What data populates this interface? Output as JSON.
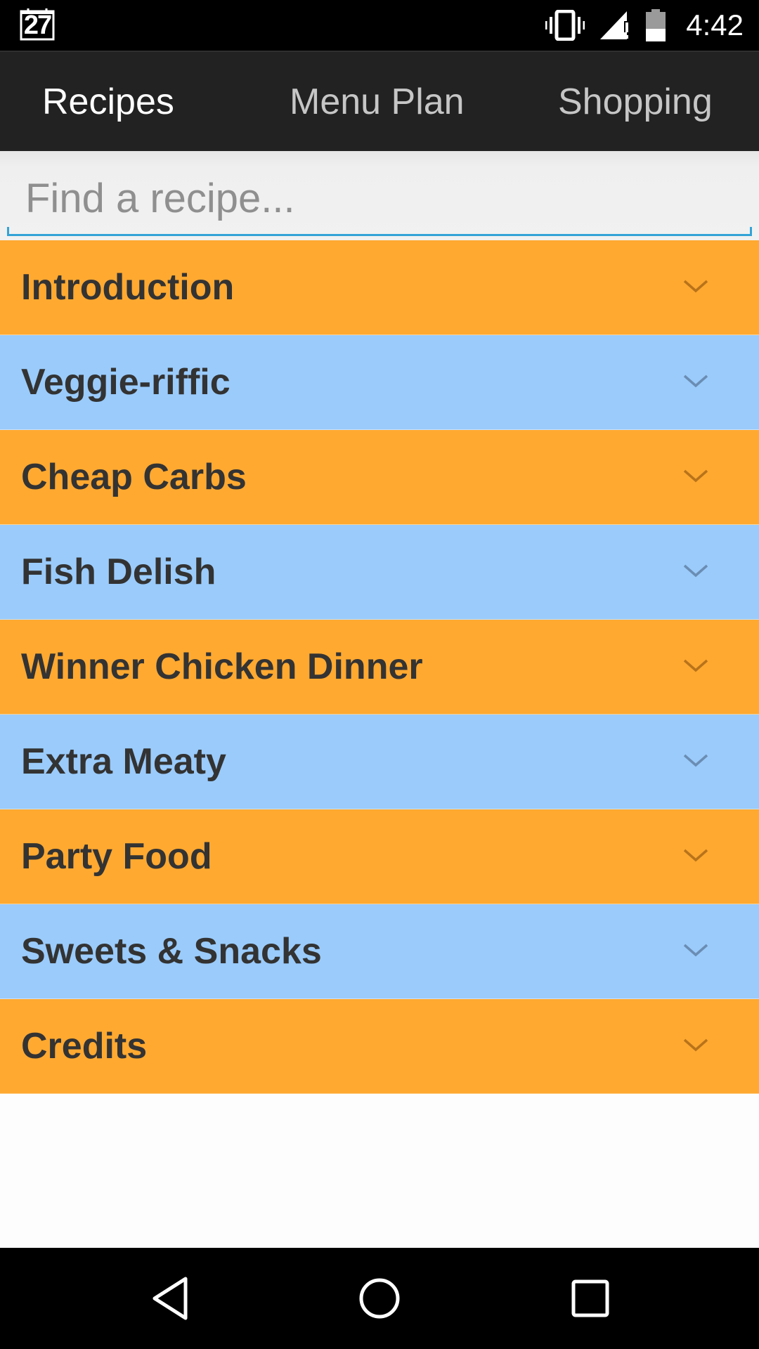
{
  "status_bar": {
    "date": "27",
    "time": "4:42",
    "icons": [
      "calendar-icon",
      "vibrate-icon",
      "signal-icon",
      "battery-icon"
    ]
  },
  "tabs": [
    {
      "label": "Recipes",
      "active": true
    },
    {
      "label": "Menu Plan",
      "active": false
    },
    {
      "label": "Shopping",
      "active": false
    }
  ],
  "search": {
    "placeholder": "Find a recipe...",
    "value": ""
  },
  "categories": [
    {
      "label": "Introduction",
      "color": "#ffa931"
    },
    {
      "label": "Veggie-riffic",
      "color": "#9acbfb"
    },
    {
      "label": "Cheap Carbs",
      "color": "#ffa931"
    },
    {
      "label": "Fish Delish",
      "color": "#9acbfb"
    },
    {
      "label": "Winner Chicken Dinner",
      "color": "#ffa931"
    },
    {
      "label": "Extra Meaty",
      "color": "#9acbfb"
    },
    {
      "label": "Party Food",
      "color": "#ffa931"
    },
    {
      "label": "Sweets & Snacks",
      "color": "#9acbfb"
    },
    {
      "label": "Credits",
      "color": "#ffa931"
    }
  ],
  "nav_bar": {
    "icons": [
      "back-icon",
      "home-icon",
      "recents-icon"
    ]
  },
  "colors": {
    "tab_bar_bg": "#222222",
    "accent": "#33a3d6",
    "orange": "#ffa931",
    "blue": "#9acbfb"
  }
}
